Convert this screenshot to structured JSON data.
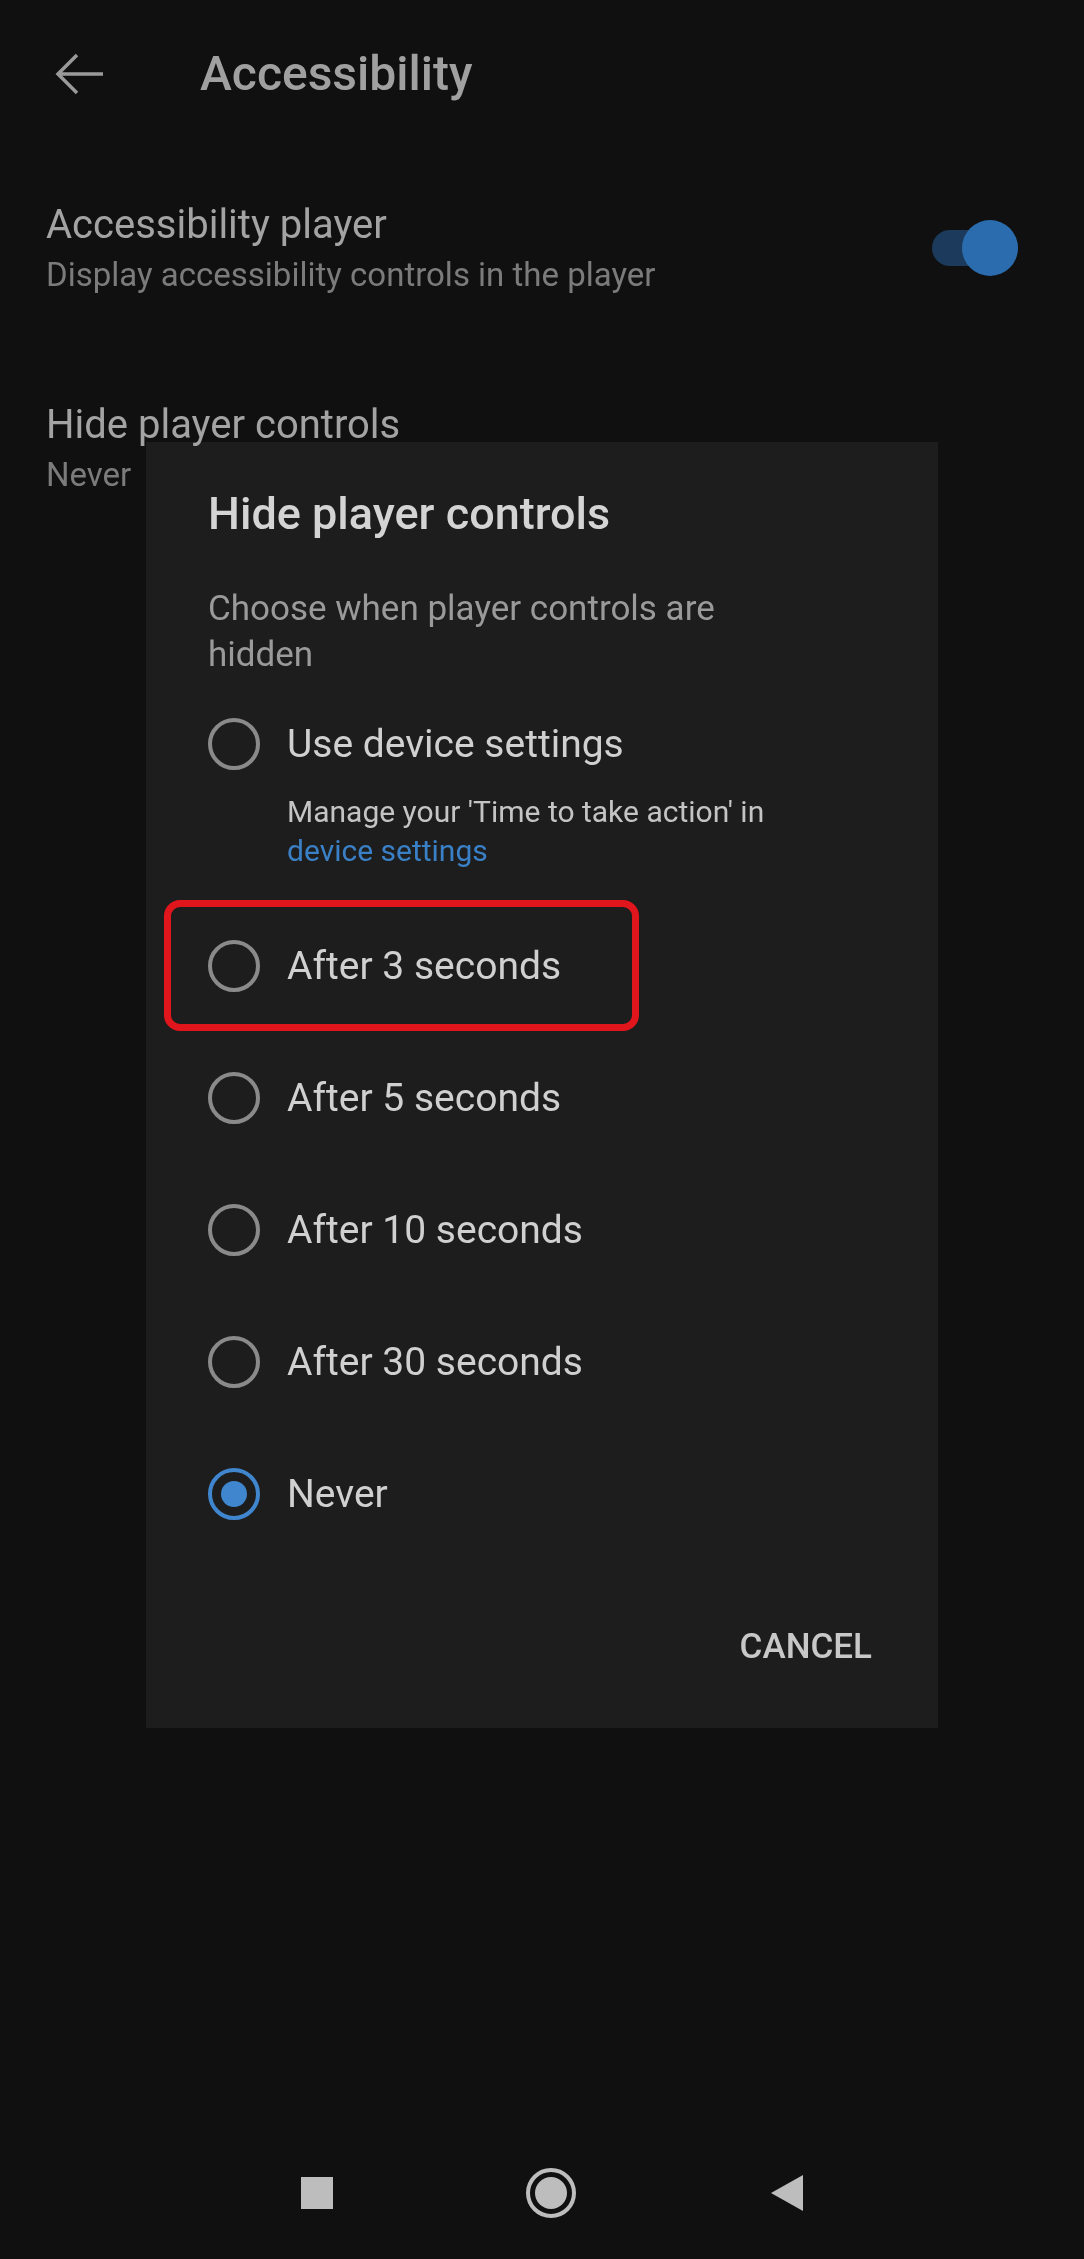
{
  "header": {
    "title": "Accessibility"
  },
  "settings": [
    {
      "title": "Accessibility player",
      "subtitle": "Display accessibility controls in the player",
      "kind": "toggle",
      "on": true
    },
    {
      "title": "Hide player controls",
      "subtitle": "Never",
      "kind": "value"
    }
  ],
  "dialog": {
    "title": "Hide player controls",
    "description": "Choose when player controls are hidden",
    "options": [
      {
        "label": "Use device settings",
        "note": "Manage your 'Time to take action' in",
        "link": "device settings",
        "selected": false,
        "highlighted": false
      },
      {
        "label": "After 3 seconds",
        "selected": false,
        "highlighted": true
      },
      {
        "label": "After 5 seconds",
        "selected": false,
        "highlighted": false
      },
      {
        "label": "After 10 seconds",
        "selected": false,
        "highlighted": false
      },
      {
        "label": "After 30 seconds",
        "selected": false,
        "highlighted": false
      },
      {
        "label": "Never",
        "selected": true,
        "highlighted": false
      }
    ],
    "buttons": [
      "CANCEL"
    ]
  }
}
